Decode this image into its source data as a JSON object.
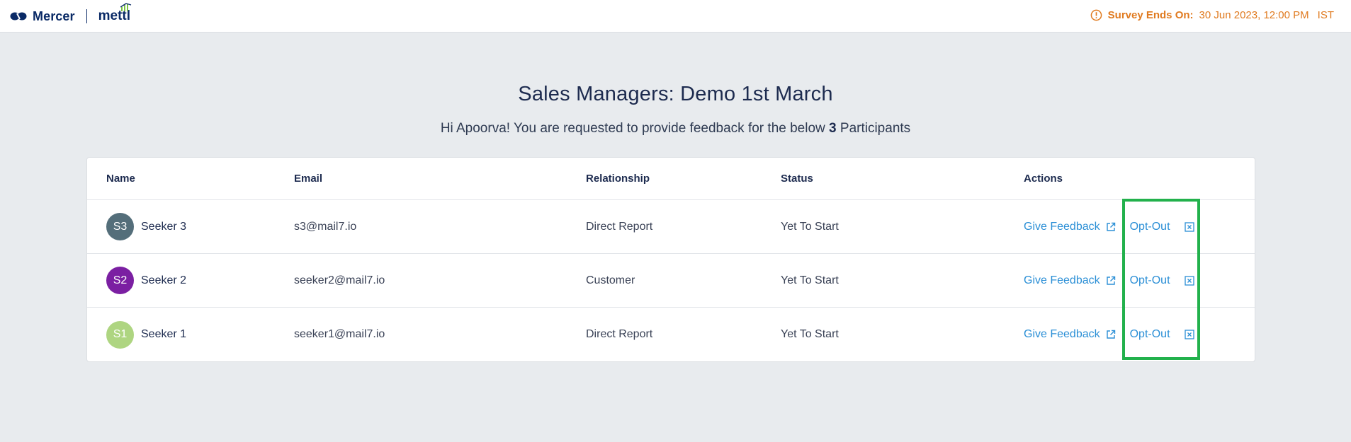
{
  "header": {
    "brand_primary": "Mercer",
    "brand_secondary": "mettl",
    "deadline_label": "Survey Ends On:",
    "deadline_value": "30 Jun 2023, 12:00 PM",
    "deadline_timezone": "IST",
    "accent_color": "#e07a1f"
  },
  "main": {
    "title": "Sales Managers: Demo 1st March",
    "subtitle_prefix": "Hi Apoorva! You are requested to provide feedback for the below",
    "participant_count": "3",
    "subtitle_suffix": "Participants"
  },
  "table": {
    "columns": [
      "Name",
      "Email",
      "Relationship",
      "Status",
      "Actions"
    ],
    "rows": [
      {
        "initials": "S3",
        "avatar_color": "#546e7a",
        "name": "Seeker 3",
        "email": "s3@mail7.io",
        "relationship": "Direct Report",
        "status": "Yet To Start",
        "give_feedback": "Give Feedback",
        "opt_out": "Opt-Out"
      },
      {
        "initials": "S2",
        "avatar_color": "#7b1fa2",
        "name": "Seeker 2",
        "email": "seeker2@mail7.io",
        "relationship": "Customer",
        "status": "Yet To Start",
        "give_feedback": "Give Feedback",
        "opt_out": "Opt-Out"
      },
      {
        "initials": "S1",
        "avatar_color": "#aed581",
        "name": "Seeker 1",
        "email": "seeker1@mail7.io",
        "relationship": "Direct Report",
        "status": "Yet To Start",
        "give_feedback": "Give Feedback",
        "opt_out": "Opt-Out"
      }
    ],
    "link_color": "#2b8fd6"
  },
  "annotation": {
    "highlight_color": "#22b14c",
    "highlight_target": "opt-out-column"
  }
}
